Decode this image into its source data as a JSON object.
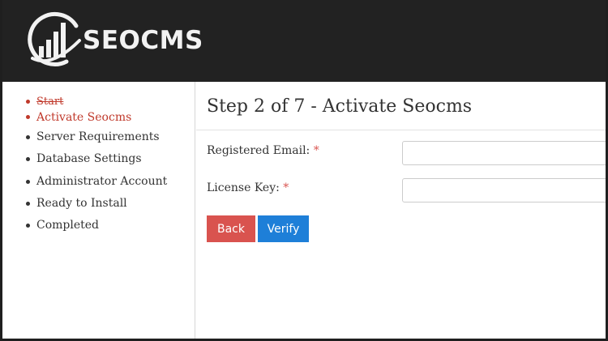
{
  "header": {
    "logo_text": "SEOCMS",
    "logo_icon": "bar-chart-swoosh-icon"
  },
  "sidebar": {
    "items": [
      {
        "label": "Start",
        "state": "completed"
      },
      {
        "label": "Activate Seocms",
        "state": "active"
      },
      {
        "label": "Server Requirements",
        "state": "pending"
      },
      {
        "label": "Database Settings",
        "state": "pending"
      },
      {
        "label": "Administrator Account",
        "state": "pending"
      },
      {
        "label": "Ready to Install",
        "state": "pending"
      },
      {
        "label": "Completed",
        "state": "pending"
      }
    ]
  },
  "main": {
    "title": "Step 2 of 7 - Activate Seocms",
    "fields": {
      "email": {
        "label": "Registered Email:",
        "required_mark": "*",
        "value": "",
        "placeholder": ""
      },
      "license": {
        "label": "License Key:",
        "required_mark": "*",
        "value": "",
        "placeholder": ""
      }
    },
    "buttons": {
      "back": "Back",
      "verify": "Verify"
    }
  },
  "colors": {
    "header_bg": "#222222",
    "active_step": "#c0392b",
    "back_button": "#d9534f",
    "verify_button": "#1e7fd8"
  }
}
